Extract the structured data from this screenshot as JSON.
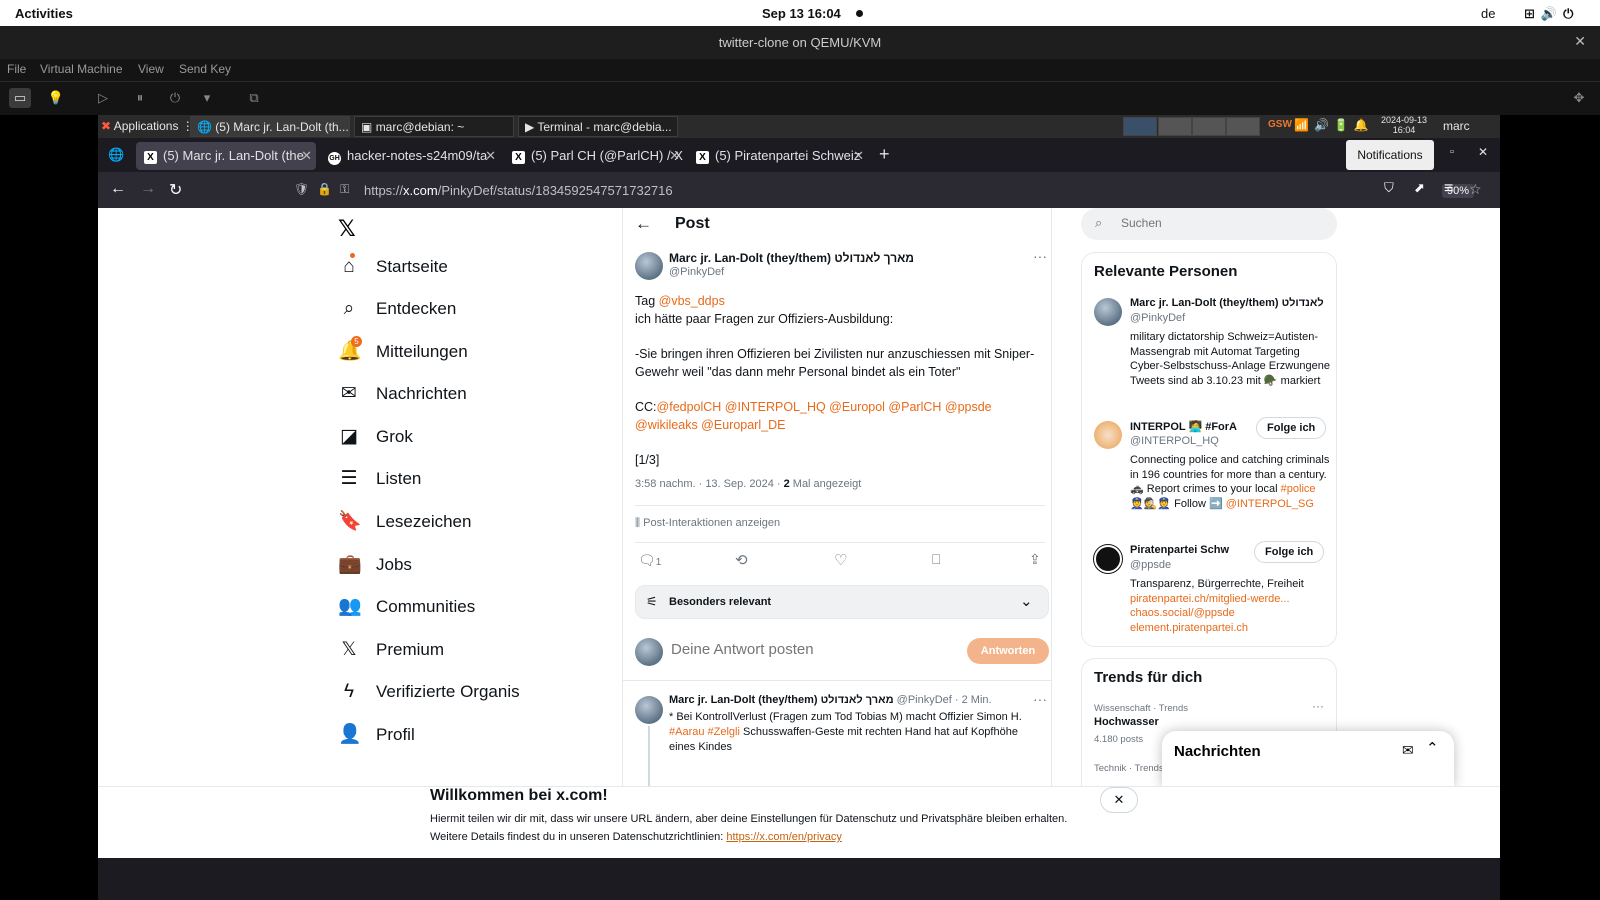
{
  "gnome": {
    "activities": "Activities",
    "clock": "Sep 13  16:04",
    "lang": "de"
  },
  "vm": {
    "title": "twitter-clone on QEMU/KVM",
    "menu": [
      "File",
      "Virtual Machine",
      "View",
      "Send Key"
    ]
  },
  "xfce": {
    "applications": "Applications",
    "tasks": [
      "(5) Marc jr. Lan-Dolt (th...",
      "marc@debian: ~",
      "Terminal - marc@debia..."
    ],
    "gsw": "GSW",
    "datetime_date": "2024-09-13",
    "datetime_time": "16:04",
    "user": "marc"
  },
  "firefox": {
    "tabs": [
      {
        "icon": "X",
        "label": "(5) Marc jr. Lan-Dolt (the"
      },
      {
        "icon": "GH",
        "label": "hacker-notes-s24m09/ta"
      },
      {
        "icon": "X",
        "label": "(5) Parl CH (@ParlCH) / X"
      },
      {
        "icon": "X",
        "label": "(5) Piratenpartei Schweiz"
      }
    ],
    "tooltip": "Notifications",
    "url_prefix": "https://",
    "url_host": "x.com",
    "url_path": "/PinkyDef/status/1834592547571732716",
    "zoom": "90%"
  },
  "nav": {
    "items": [
      {
        "label": "Startseite"
      },
      {
        "label": "Entdecken"
      },
      {
        "label": "Mitteilungen",
        "badge": "5"
      },
      {
        "label": "Nachrichten"
      },
      {
        "label": "Grok"
      },
      {
        "label": "Listen"
      },
      {
        "label": "Lesezeichen"
      },
      {
        "label": "Jobs"
      },
      {
        "label": "Communities"
      },
      {
        "label": "Premium"
      },
      {
        "label": "Verifizierte Organis"
      },
      {
        "label": "Profil"
      }
    ]
  },
  "post": {
    "header": "Post",
    "author_name": "Marc jr. Lan-Dolt (they/them) מארך לאנדולט",
    "author_handle": "@PinkyDef",
    "line1_prefix": "Tag ",
    "line1_mention": "@vbs_ddps",
    "line2": "ich hätte paar Fragen zur Offiziers-Ausbildung:",
    "para2": "-Sie bringen ihren Offizieren bei Zivilisten nur anzuschiessen mit Sniper-Gewehr weil \"das dann mehr Personal bindet als ein Toter\"",
    "cc_prefix": "CC:",
    "cc_mentions_1": "@fedpolCH  @INTERPOL_HQ  @Europol  @ParlCH  @ppsde",
    "cc_mentions_2": "@wikileaks  @Europarl_DE",
    "page_marker": "[1/3]",
    "meta_time": "3:58 nachm. · 13. Sep. 2024 · ",
    "meta_views": "2",
    "meta_views_label": " Mal angezeigt",
    "interactions": "Post-Interaktionen anzeigen",
    "reply_count": "1",
    "sort_label": "Besonders relevant",
    "reply_placeholder": "Deine Antwort posten",
    "reply_button": "Antworten"
  },
  "reply": {
    "author_name": "Marc jr. Lan-Dolt (they/them) מארך לאנדולט",
    "meta": "@PinkyDef · 2 Min.",
    "text1": "* Bei KontrollVerlust (Fragen zum Tod Tobias M) macht Offizier Simon H.",
    "tags": "#Aarau #Zelgli",
    "text2": " Schusswaffen-Geste mit rechten Hand hat auf Kopfhöhe",
    "text3": "eines Kindes"
  },
  "sidebar": {
    "search_placeholder": "Suchen",
    "people_title": "Relevante Personen",
    "people": [
      {
        "name": "Marc jr. Lan-Dolt (they/them) לאנדולט",
        "handle": "@PinkyDef",
        "bio": "military dictatorship Schweiz=Autisten-Massengrab mit Automat Targeting Cyber-Selbstschuss-Anlage Erzwungene Tweets sind ab 3.10.23 mit 🪖 markiert"
      },
      {
        "name": "INTERPOL 🧑‍💻 #ForA",
        "handle": "@INTERPOL_HQ",
        "follow": "Folge ich",
        "bio": "Connecting police and catching criminals in 196 countries for more than a century. 🚓 Report crimes to your local ",
        "bio_tag": "#police",
        "bio_rest": " 👮🕵️👮 Follow ➡️",
        "bio_link": "@INTERPOL_SG"
      },
      {
        "name": "Piratenpartei Schw",
        "handle": "@ppsde",
        "follow": "Folge ich",
        "bio": "Transparenz, Bürgerrechte, Freiheit",
        "links": [
          "piratenpartei.ch/mitglied-werde...",
          "chaos.social/@ppsde",
          "element.piratenpartei.ch"
        ]
      }
    ],
    "trends_title": "Trends für dich",
    "trend_cat": "Wissenschaft · Trends",
    "trend_name": "Hochwasser",
    "trend_count": "4.180 posts",
    "trend2_cat": "Technik · Trends",
    "messages": "Nachrichten"
  },
  "banner": {
    "title": "Willkommen bei x.com!",
    "text1": "Hiermit teilen wir dir mit, dass wir unsere URL ändern, aber deine Einstellungen für Datenschutz und Privatsphäre bleiben erhalten.",
    "text2": "Weitere Details findest du in unseren Datenschutzrichtlinien: ",
    "link": "https://x.com/en/privacy"
  },
  "colors": {
    "accent": "#e86a1a",
    "firefox_dark": "#1c1b22",
    "text": "#0f1419"
  }
}
